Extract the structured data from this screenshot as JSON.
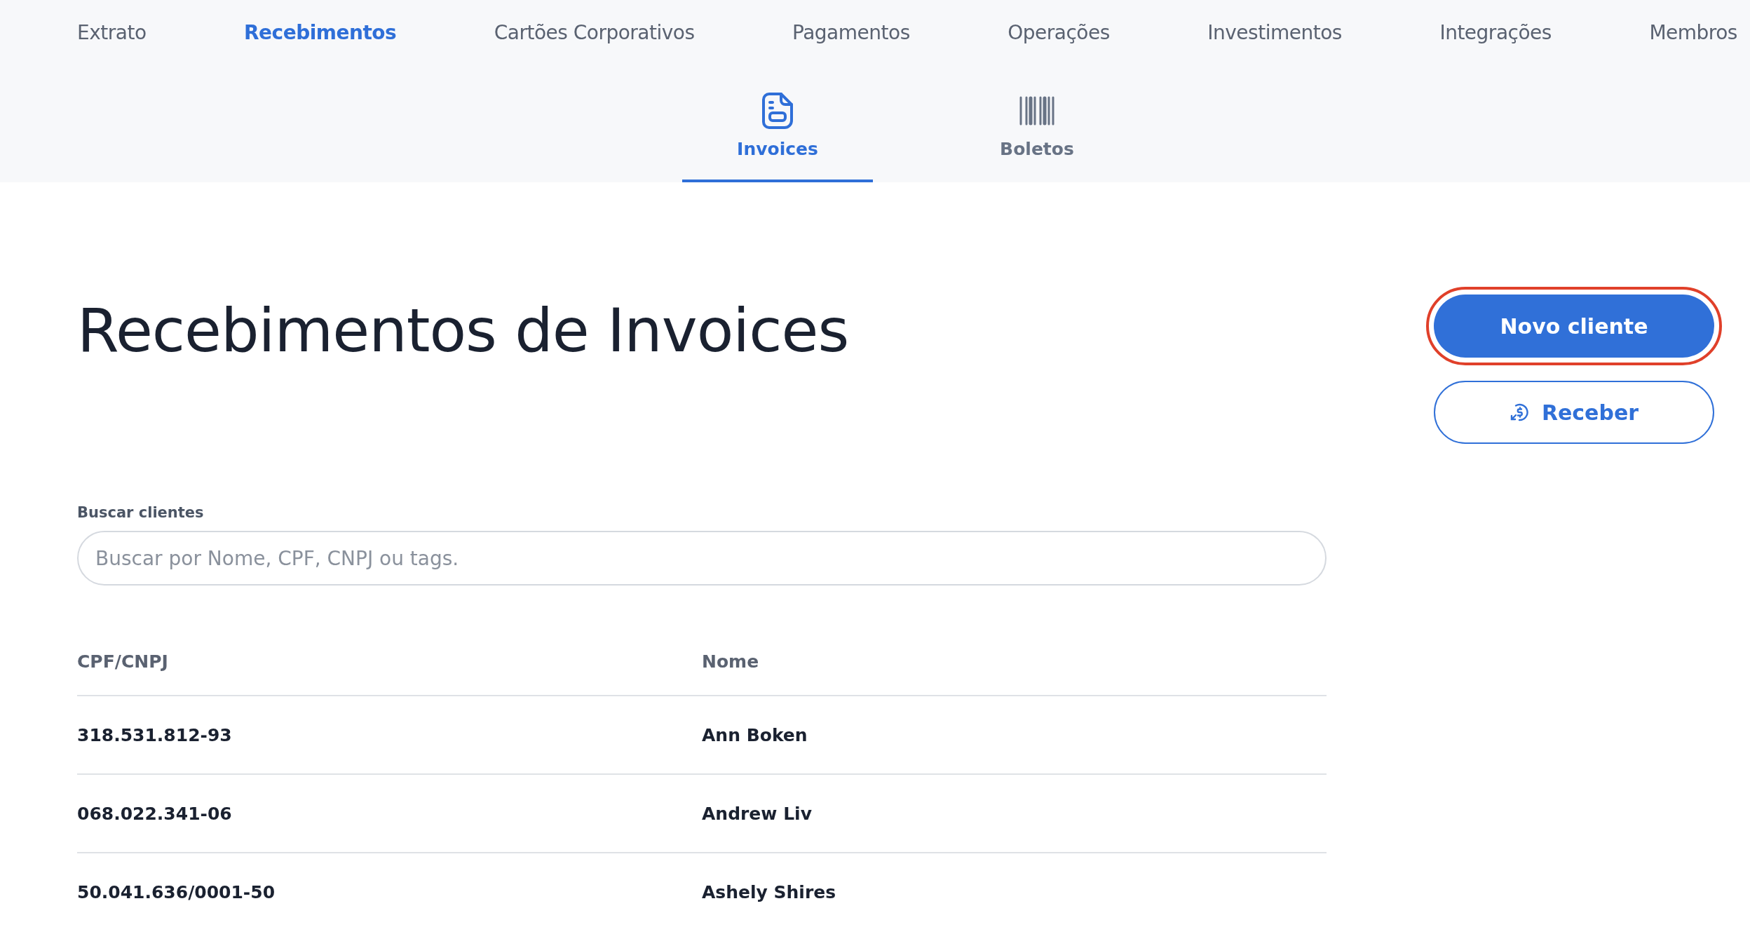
{
  "top_nav": [
    {
      "label": "Extrato",
      "selected": false
    },
    {
      "label": "Recebimentos",
      "selected": true
    },
    {
      "label": "Cartões Corporativos",
      "selected": false
    },
    {
      "label": "Pagamentos",
      "selected": false
    },
    {
      "label": "Operações",
      "selected": false
    },
    {
      "label": "Investimentos",
      "selected": false
    },
    {
      "label": "Integrações",
      "selected": false
    },
    {
      "label": "Membros",
      "selected": false
    }
  ],
  "sub_tabs": [
    {
      "label": "Invoices",
      "kind": "invoice",
      "selected": true
    },
    {
      "label": "Boletos",
      "kind": "barcode",
      "selected": false
    }
  ],
  "page_title": "Recebimentos de Invoices",
  "actions": [
    {
      "label": "Novo cliente",
      "kind": "primary",
      "highlighted": true
    },
    {
      "label": "Receber",
      "kind": "secondary",
      "highlighted": false
    }
  ],
  "search": {
    "label": "Buscar clientes",
    "placeholder": "Buscar por Nome, CPF, CNPJ ou tags."
  },
  "table": {
    "columns": [
      "CPF/CNPJ",
      "Nome"
    ],
    "rows": [
      [
        "318.531.812-93",
        "Ann Boken"
      ],
      [
        "068.022.341-06",
        "Andrew Liv"
      ],
      [
        "50.041.636/0001-50",
        "Ashely Shires"
      ]
    ]
  }
}
